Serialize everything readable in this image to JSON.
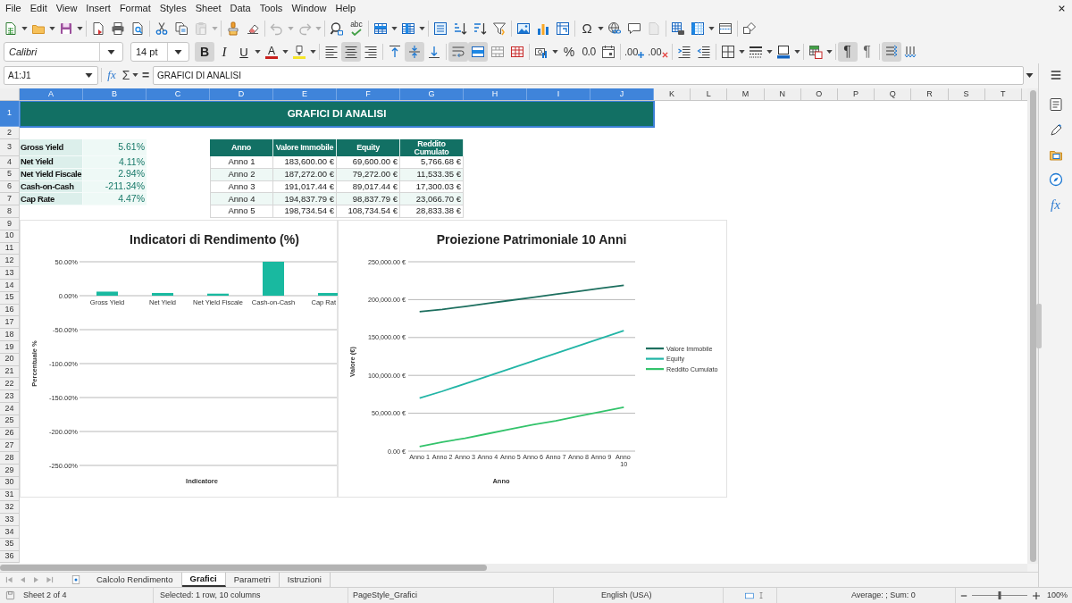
{
  "menu_bar": [
    "File",
    "Edit",
    "View",
    "Insert",
    "Format",
    "Styles",
    "Sheet",
    "Data",
    "Tools",
    "Window",
    "Help"
  ],
  "standard_toolbar": [
    [
      {
        "kind": "new",
        "disabled": false
      },
      {
        "kind": "open",
        "disabled": false
      },
      {
        "kind": "save",
        "disabled": false
      }
    ],
    [
      {
        "kind": "export_pdf",
        "disabled": false
      },
      {
        "kind": "print",
        "disabled": false
      },
      {
        "kind": "print_preview",
        "disabled": false
      }
    ],
    [
      {
        "kind": "cut",
        "disabled": false
      },
      {
        "kind": "copy",
        "disabled": false
      },
      {
        "kind": "paste",
        "disabled": true
      }
    ],
    [
      {
        "kind": "clone_format",
        "disabled": false
      },
      {
        "kind": "clear_format",
        "disabled": false
      }
    ],
    [
      {
        "kind": "undo",
        "disabled": true
      },
      {
        "kind": "redo",
        "disabled": true
      }
    ],
    [
      {
        "kind": "find_replace",
        "disabled": false
      },
      {
        "kind": "spelling",
        "glyph": "abc",
        "disabled": false
      }
    ],
    [
      {
        "kind": "rows",
        "disabled": false
      },
      {
        "kind": "columns",
        "disabled": false
      }
    ],
    [
      {
        "kind": "sort",
        "disabled": false
      },
      {
        "kind": "sort_asc",
        "disabled": false
      },
      {
        "kind": "sort_desc",
        "disabled": false
      },
      {
        "kind": "autofilter",
        "disabled": false
      }
    ],
    [
      {
        "kind": "image",
        "disabled": false
      },
      {
        "kind": "chart",
        "disabled": false
      },
      {
        "kind": "pivot",
        "disabled": false
      }
    ],
    [
      {
        "kind": "special_char",
        "glyph": "Ω",
        "disabled": false
      },
      {
        "kind": "hyperlink",
        "disabled": false
      },
      {
        "kind": "comment",
        "disabled": false
      },
      {
        "kind": "header_footer",
        "disabled": true
      }
    ],
    [
      {
        "kind": "print_range",
        "disabled": false
      },
      {
        "kind": "freeze",
        "disabled": false
      },
      {
        "kind": "split",
        "disabled": false
      }
    ],
    [
      {
        "kind": "draw_functions",
        "disabled": false
      }
    ]
  ],
  "format_toolbar": {
    "font_name": "Calibri",
    "font_size": "14 pt",
    "groups": [
      [
        {
          "kind": "bold",
          "glyph": "B",
          "on": true
        },
        {
          "kind": "italic",
          "glyph": "I",
          "on": false
        },
        {
          "kind": "underline",
          "glyph": "U",
          "on": false
        },
        {
          "kind": "font_color",
          "glyph": "A",
          "on": false
        },
        {
          "kind": "highlight",
          "on": false
        }
      ],
      [
        {
          "kind": "align_left",
          "on": false
        },
        {
          "kind": "align_center",
          "on": true
        },
        {
          "kind": "align_right",
          "on": false
        }
      ],
      [
        {
          "kind": "align_top",
          "on": false
        },
        {
          "kind": "align_middle",
          "on": true
        },
        {
          "kind": "align_bottom",
          "on": false
        }
      ],
      [
        {
          "kind": "wrap",
          "on": true
        },
        {
          "kind": "merge_center",
          "on": true
        },
        {
          "kind": "merge",
          "on": false
        },
        {
          "kind": "unmerge",
          "on": false
        }
      ],
      [
        {
          "kind": "currency",
          "on": false
        },
        {
          "kind": "percent",
          "glyph": "%",
          "on": false
        },
        {
          "kind": "number",
          "glyph": "0.0",
          "on": false
        },
        {
          "kind": "date",
          "on": false
        }
      ],
      [
        {
          "kind": "add_decimal",
          "glyph": ".00",
          "on": false
        },
        {
          "kind": "delete_decimal",
          "glyph": ".00",
          "on": false
        }
      ],
      [
        {
          "kind": "indent_more",
          "on": false
        },
        {
          "kind": "indent_less",
          "on": false
        }
      ],
      [
        {
          "kind": "borders",
          "on": false
        },
        {
          "kind": "border_style",
          "on": false
        },
        {
          "kind": "border_color",
          "on": false
        }
      ],
      [
        {
          "kind": "conditional",
          "on": false
        }
      ],
      [
        {
          "kind": "ltr",
          "glyph": "¶",
          "on": true
        },
        {
          "kind": "rtl",
          "glyph": "¶",
          "on": false
        }
      ],
      [
        {
          "kind": "text_horizontal",
          "on": true
        },
        {
          "kind": "text_vertical",
          "on": false
        }
      ]
    ]
  },
  "formula_bar": {
    "name_box": "A1:J1",
    "function_wizard": "fx",
    "sum": "Σ",
    "equals": "=",
    "content": "GRAFICI DI ANALISI"
  },
  "column_headers": [
    {
      "label": "A",
      "selected": true
    },
    {
      "label": "B",
      "selected": true
    },
    {
      "label": "C",
      "selected": true
    },
    {
      "label": "D",
      "selected": true
    },
    {
      "label": "E",
      "selected": true
    },
    {
      "label": "F",
      "selected": true
    },
    {
      "label": "G",
      "selected": true
    },
    {
      "label": "H",
      "selected": true
    },
    {
      "label": "I",
      "selected": true
    },
    {
      "label": "J",
      "selected": true
    },
    {
      "label": "K",
      "selected": false
    },
    {
      "label": "L",
      "selected": false
    },
    {
      "label": "M",
      "selected": false
    },
    {
      "label": "N",
      "selected": false
    },
    {
      "label": "O",
      "selected": false
    },
    {
      "label": "P",
      "selected": false
    },
    {
      "label": "Q",
      "selected": false
    },
    {
      "label": "R",
      "selected": false
    },
    {
      "label": "S",
      "selected": false
    },
    {
      "label": "T",
      "selected": false
    }
  ],
  "row_headers": [
    {
      "label": "1",
      "selected": true
    },
    {
      "label": "2",
      "selected": false
    },
    {
      "label": "3",
      "selected": false
    },
    {
      "label": "4",
      "selected": false
    },
    {
      "label": "5",
      "selected": false
    },
    {
      "label": "6",
      "selected": false
    },
    {
      "label": "7",
      "selected": false
    },
    {
      "label": "8",
      "selected": false
    },
    {
      "label": "9",
      "selected": false
    },
    {
      "label": "10",
      "selected": false
    },
    {
      "label": "11",
      "selected": false
    },
    {
      "label": "12",
      "selected": false
    },
    {
      "label": "13",
      "selected": false
    },
    {
      "label": "14",
      "selected": false
    },
    {
      "label": "15",
      "selected": false
    },
    {
      "label": "16",
      "selected": false
    },
    {
      "label": "17",
      "selected": false
    },
    {
      "label": "18",
      "selected": false
    },
    {
      "label": "19",
      "selected": false
    },
    {
      "label": "20",
      "selected": false
    },
    {
      "label": "21",
      "selected": false
    },
    {
      "label": "22",
      "selected": false
    },
    {
      "label": "23",
      "selected": false
    },
    {
      "label": "24",
      "selected": false
    },
    {
      "label": "25",
      "selected": false
    },
    {
      "label": "26",
      "selected": false
    },
    {
      "label": "27",
      "selected": false
    },
    {
      "label": "28",
      "selected": false
    },
    {
      "label": "29",
      "selected": false
    },
    {
      "label": "30",
      "selected": false
    },
    {
      "label": "31",
      "selected": false
    },
    {
      "label": "32",
      "selected": false
    },
    {
      "label": "33",
      "selected": false
    },
    {
      "label": "34",
      "selected": false
    },
    {
      "label": "35",
      "selected": false
    },
    {
      "label": "36",
      "selected": false
    }
  ],
  "sheet": {
    "title_cell": {
      "text": "GRAFICI DI ANALISI",
      "selected": true
    },
    "kpi_table": [
      {
        "label": "Gross Yield",
        "value": "5.61%"
      },
      {
        "label": "Net Yield",
        "value": "4.11%"
      },
      {
        "label": "Net Yield Fiscale",
        "value": "2.94%"
      },
      {
        "label": "Cash-on-Cash",
        "value": "-211.34%"
      },
      {
        "label": "Cap Rate",
        "value": "4.47%"
      }
    ],
    "projection_table": {
      "columns": [
        "Anno",
        "Valore Immobile",
        "Equity",
        "Reddito Cumulato"
      ],
      "rows": [
        [
          "Anno 1",
          "183,600.00 €",
          "69,600.00 €",
          "5,766.68 €"
        ],
        [
          "Anno 2",
          "187,272.00 €",
          "79,272.00 €",
          "11,533.35 €"
        ],
        [
          "Anno 3",
          "191,017.44 €",
          "89,017.44 €",
          "17,300.03 €"
        ],
        [
          "Anno 4",
          "194,837.79 €",
          "98,837.79 €",
          "23,066.70 €"
        ],
        [
          "Anno 5",
          "198,734.54 €",
          "108,734.54 €",
          "28,833.38 €"
        ]
      ]
    },
    "chart_data": [
      {
        "type": "bar",
        "title": "Indicatori di Rendimento (%)",
        "xlabel": "Indicatore",
        "ylabel": "Percentuale %",
        "categories": [
          "Gross Yield",
          "Net Yield",
          "Net Yield Fiscale",
          "Cash-on-Cash",
          "Cap Rat"
        ],
        "values": [
          6,
          4,
          3,
          50,
          4
        ],
        "color": "#19b9a0",
        "ylim": [
          -250,
          50
        ],
        "yticks": [
          {
            "value": 50,
            "label": "50.00%"
          },
          {
            "value": 0,
            "label": "0.00%"
          },
          {
            "value": -50,
            "label": "-50.00%"
          },
          {
            "value": -100,
            "label": "-100.00%"
          },
          {
            "value": -150,
            "label": "-150.00%"
          },
          {
            "value": -200,
            "label": "-200.00%"
          },
          {
            "value": -250,
            "label": "-250.00%"
          }
        ],
        "grid": true
      },
      {
        "type": "line",
        "title": "Proiezione Patrimoniale 10 Anni",
        "xlabel": "Anno",
        "ylabel": "Valore (€)",
        "categories": [
          "Anno 1",
          "Anno 2",
          "Anno 3",
          "Anno 4",
          "Anno 5",
          "Anno 6",
          "Anno 7",
          "Anno 8",
          "Anno 9",
          "Anno 10"
        ],
        "series": [
          {
            "name": "Valore Immobile",
            "color": "#1d6f5f",
            "values": [
              184000,
              187000,
              191000,
              195000,
              199000,
              203000,
              207000,
              211000,
              215000,
              219000
            ]
          },
          {
            "name": "Equity",
            "color": "#22b5a6",
            "values": [
              70000,
              79000,
              89000,
              99000,
              109000,
              119000,
              129000,
              139000,
              149000,
              159000
            ]
          },
          {
            "name": "Reddito Cumulato",
            "color": "#33c36b",
            "values": [
              6000,
              12000,
              17000,
              23000,
              29000,
              35000,
              40000,
              46000,
              52000,
              58000
            ]
          }
        ],
        "ylim": [
          0,
          250000
        ],
        "yticks": [
          {
            "value": 250000,
            "label": "250,000.00 €"
          },
          {
            "value": 200000,
            "label": "200,000.00 €"
          },
          {
            "value": 150000,
            "label": "150,000.00 €"
          },
          {
            "value": 100000,
            "label": "100,000.00 €"
          },
          {
            "value": 50000,
            "label": "50,000.00 €"
          },
          {
            "value": 0,
            "label": "0.00 €"
          }
        ],
        "legend": "right",
        "grid": true
      }
    ]
  },
  "sheet_tabs": [
    {
      "label": "Calcolo Rendimento",
      "selected": false
    },
    {
      "label": "Grafici",
      "selected": true
    },
    {
      "label": "Parametri",
      "selected": false
    },
    {
      "label": "Istruzioni",
      "selected": false
    }
  ],
  "sidebar": {
    "functions_glyph": "fx"
  },
  "status_bar": {
    "sheet": "Sheet 2 of 4",
    "selection": "Selected: 1 row, 10 columns",
    "page_style": "PageStyle_Grafici",
    "language": "English (USA)",
    "summary": "Average: ; Sum: 0",
    "zoom_slider": {
      "level": 0.5
    },
    "zoom": "100%"
  }
}
